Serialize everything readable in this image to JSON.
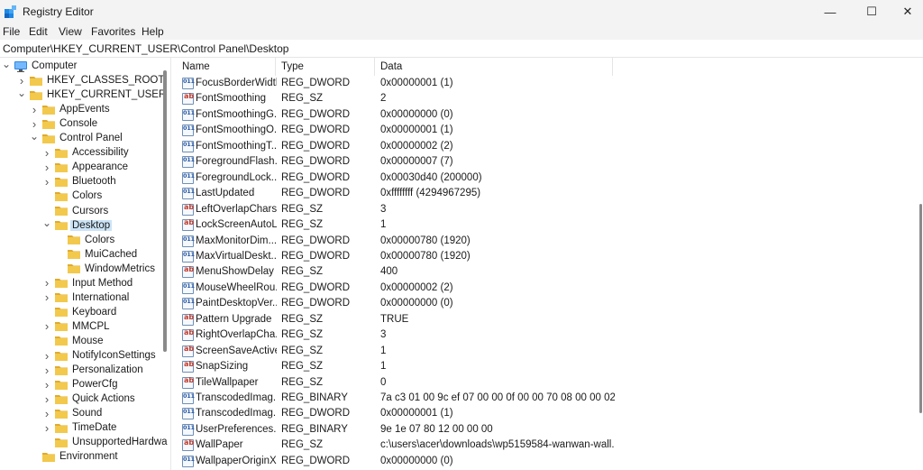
{
  "window": {
    "title": "Registry Editor",
    "minimize_glyph": "—",
    "maximize_glyph": "☐",
    "close_glyph": "✕"
  },
  "menu": [
    "File",
    "Edit",
    "View",
    "Favorites",
    "Help"
  ],
  "address": "Computer\\HKEY_CURRENT_USER\\Control Panel\\Desktop",
  "colors": {
    "folder": "#f2c94c",
    "folder_dark": "#e0ab2d",
    "selection": "#cce4f7"
  },
  "tree": [
    {
      "label": "Computer",
      "depth": 0,
      "chevron": "down",
      "icon": "computer-icon"
    },
    {
      "label": "HKEY_CLASSES_ROOT",
      "depth": 1,
      "chevron": "right",
      "icon": "folder-icon"
    },
    {
      "label": "HKEY_CURRENT_USER",
      "depth": 1,
      "chevron": "down",
      "icon": "folder-icon"
    },
    {
      "label": "AppEvents",
      "depth": 2,
      "chevron": "right",
      "icon": "folder-icon"
    },
    {
      "label": "Console",
      "depth": 2,
      "chevron": "right",
      "icon": "folder-icon"
    },
    {
      "label": "Control Panel",
      "depth": 2,
      "chevron": "down",
      "icon": "folder-icon"
    },
    {
      "label": "Accessibility",
      "depth": 3,
      "chevron": "right",
      "icon": "folder-icon"
    },
    {
      "label": "Appearance",
      "depth": 3,
      "chevron": "right",
      "icon": "folder-icon"
    },
    {
      "label": "Bluetooth",
      "depth": 3,
      "chevron": "right",
      "icon": "folder-icon"
    },
    {
      "label": "Colors",
      "depth": 3,
      "chevron": "",
      "icon": "folder-icon"
    },
    {
      "label": "Cursors",
      "depth": 3,
      "chevron": "",
      "icon": "folder-icon"
    },
    {
      "label": "Desktop",
      "depth": 3,
      "chevron": "down",
      "icon": "folder-icon",
      "selected": true
    },
    {
      "label": "Colors",
      "depth": 4,
      "chevron": "",
      "icon": "folder-icon"
    },
    {
      "label": "MuiCached",
      "depth": 4,
      "chevron": "",
      "icon": "folder-icon"
    },
    {
      "label": "WindowMetrics",
      "depth": 4,
      "chevron": "",
      "icon": "folder-icon"
    },
    {
      "label": "Input Method",
      "depth": 3,
      "chevron": "right",
      "icon": "folder-icon"
    },
    {
      "label": "International",
      "depth": 3,
      "chevron": "right",
      "icon": "folder-icon"
    },
    {
      "label": "Keyboard",
      "depth": 3,
      "chevron": "",
      "icon": "folder-icon"
    },
    {
      "label": "MMCPL",
      "depth": 3,
      "chevron": "right",
      "icon": "folder-icon"
    },
    {
      "label": "Mouse",
      "depth": 3,
      "chevron": "",
      "icon": "folder-icon"
    },
    {
      "label": "NotifyIconSettings",
      "depth": 3,
      "chevron": "right",
      "icon": "folder-icon"
    },
    {
      "label": "Personalization",
      "depth": 3,
      "chevron": "right",
      "icon": "folder-icon"
    },
    {
      "label": "PowerCfg",
      "depth": 3,
      "chevron": "right",
      "icon": "folder-icon"
    },
    {
      "label": "Quick Actions",
      "depth": 3,
      "chevron": "right",
      "icon": "folder-icon"
    },
    {
      "label": "Sound",
      "depth": 3,
      "chevron": "right",
      "icon": "folder-icon"
    },
    {
      "label": "TimeDate",
      "depth": 3,
      "chevron": "right",
      "icon": "folder-icon"
    },
    {
      "label": "UnsupportedHardwa",
      "depth": 3,
      "chevron": "",
      "icon": "folder-icon"
    },
    {
      "label": "Environment",
      "depth": 2,
      "chevron": "",
      "icon": "folder-icon"
    }
  ],
  "columns": {
    "name": "Name",
    "type": "Type",
    "data": "Data"
  },
  "values": [
    {
      "name": "FocusBorderWidth",
      "type": "REG_DWORD",
      "data": "0x00000001 (1)"
    },
    {
      "name": "FontSmoothing",
      "type": "REG_SZ",
      "data": "2"
    },
    {
      "name": "FontSmoothingG...",
      "type": "REG_DWORD",
      "data": "0x00000000 (0)"
    },
    {
      "name": "FontSmoothingO...",
      "type": "REG_DWORD",
      "data": "0x00000001 (1)"
    },
    {
      "name": "FontSmoothingT...",
      "type": "REG_DWORD",
      "data": "0x00000002 (2)"
    },
    {
      "name": "ForegroundFlash...",
      "type": "REG_DWORD",
      "data": "0x00000007 (7)"
    },
    {
      "name": "ForegroundLock...",
      "type": "REG_DWORD",
      "data": "0x00030d40 (200000)"
    },
    {
      "name": "LastUpdated",
      "type": "REG_DWORD",
      "data": "0xffffffff (4294967295)"
    },
    {
      "name": "LeftOverlapChars",
      "type": "REG_SZ",
      "data": "3"
    },
    {
      "name": "LockScreenAutoL...",
      "type": "REG_SZ",
      "data": "1"
    },
    {
      "name": "MaxMonitorDim...",
      "type": "REG_DWORD",
      "data": "0x00000780 (1920)"
    },
    {
      "name": "MaxVirtualDeskt...",
      "type": "REG_DWORD",
      "data": "0x00000780 (1920)"
    },
    {
      "name": "MenuShowDelay",
      "type": "REG_SZ",
      "data": "400"
    },
    {
      "name": "MouseWheelRou...",
      "type": "REG_DWORD",
      "data": "0x00000002 (2)"
    },
    {
      "name": "PaintDesktopVer...",
      "type": "REG_DWORD",
      "data": "0x00000000 (0)"
    },
    {
      "name": "Pattern Upgrade",
      "type": "REG_SZ",
      "data": "TRUE"
    },
    {
      "name": "RightOverlapCha...",
      "type": "REG_SZ",
      "data": "3"
    },
    {
      "name": "ScreenSaveActive",
      "type": "REG_SZ",
      "data": "1"
    },
    {
      "name": "SnapSizing",
      "type": "REG_SZ",
      "data": "1"
    },
    {
      "name": "TileWallpaper",
      "type": "REG_SZ",
      "data": "0"
    },
    {
      "name": "TranscodedImag...",
      "type": "REG_BINARY",
      "data": "7a c3 01 00 9c ef 07 00 00 0f 00 00 70 08 00 00 02 ..."
    },
    {
      "name": "TranscodedImag...",
      "type": "REG_DWORD",
      "data": "0x00000001 (1)"
    },
    {
      "name": "UserPreferences...",
      "type": "REG_BINARY",
      "data": "9e 1e 07 80 12 00 00 00"
    },
    {
      "name": "WallPaper",
      "type": "REG_SZ",
      "data": "c:\\users\\acer\\downloads\\wp5159584-wanwan-wall..."
    },
    {
      "name": "WallpaperOriginX",
      "type": "REG_DWORD",
      "data": "0x00000000 (0)"
    }
  ]
}
